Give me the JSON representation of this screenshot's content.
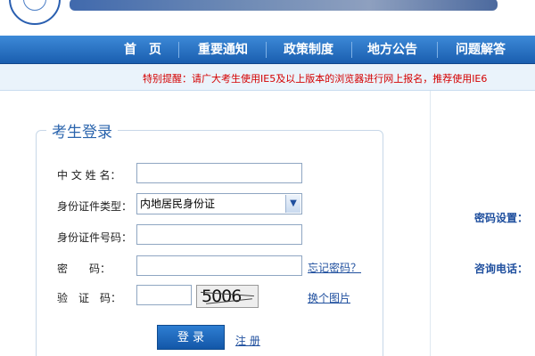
{
  "header": {
    "logo_text": "〜"
  },
  "nav": {
    "items": [
      {
        "label": "首　页"
      },
      {
        "label": "重要通知"
      },
      {
        "label": "政策制度"
      },
      {
        "label": "地方公告"
      },
      {
        "label": "问题解答"
      }
    ]
  },
  "notice": {
    "text": "特别提醒：请广大考生使用IE5及以上版本的浏览器进行网上报名，推荐使用IE6"
  },
  "login": {
    "title": "考生登录",
    "name_label": "中 文 姓 名：",
    "name_value": "",
    "id_type_label": "身份证件类型：",
    "id_type_value": "内地居民身份证",
    "id_number_label": "身份证件号码：",
    "id_number_value": "",
    "password_label": "密　　码：",
    "password_value": "",
    "forgot_password": "忘记密码？",
    "captcha_label": "验　证　码：",
    "captcha_value": "",
    "captcha_image_text": "5006",
    "refresh_captcha": "换个图片",
    "login_button": "登 录",
    "register_link": "注 册"
  },
  "right_panel": {
    "password_setting": "密码设置：",
    "consult_phone": "咨询电话："
  },
  "colors": {
    "nav_blue": "#1a5eaf",
    "notice_red": "#d40000",
    "link_blue": "#1f4f9e"
  }
}
